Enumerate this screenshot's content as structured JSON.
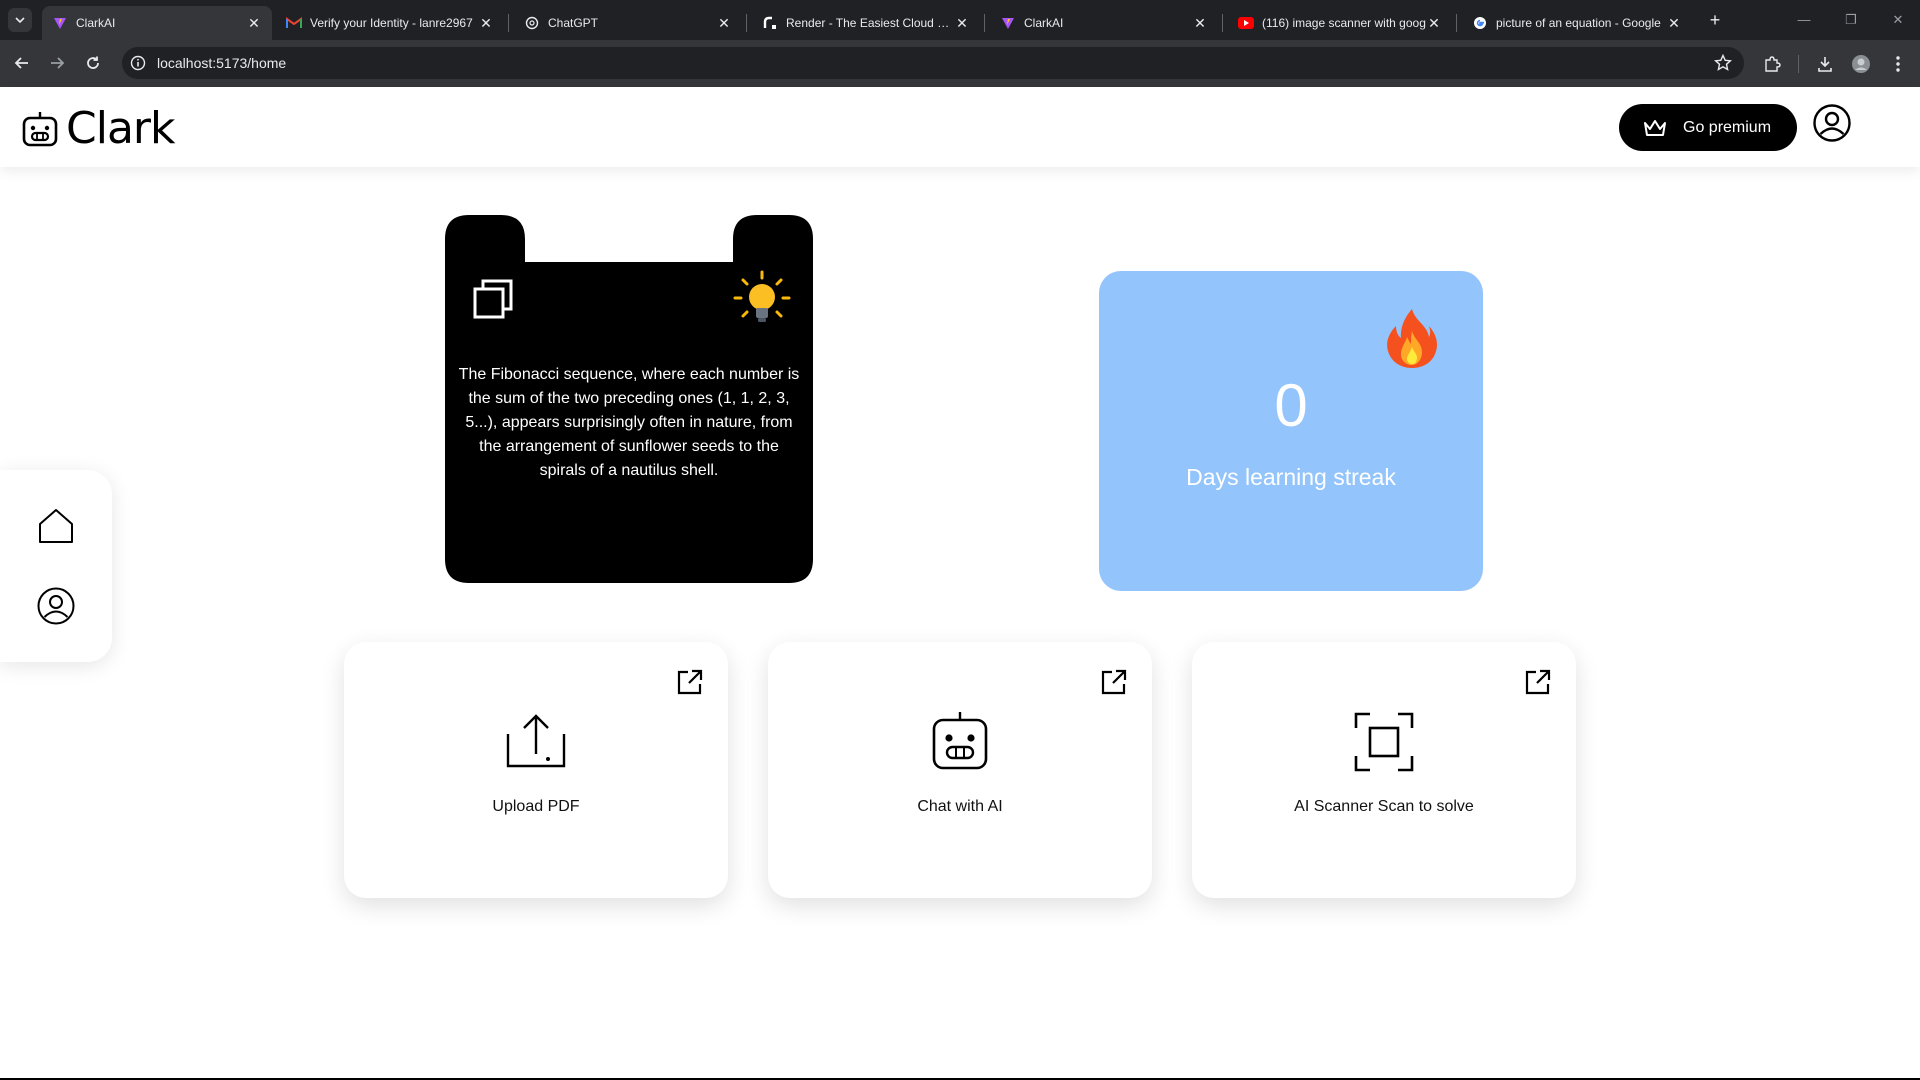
{
  "browser": {
    "tabs": [
      {
        "title": "ClarkAI",
        "favicon": "vite-icon",
        "active": true
      },
      {
        "title": "Verify your Identity - lanre2967",
        "favicon": "gmail-icon",
        "active": false
      },
      {
        "title": "ChatGPT",
        "favicon": "openai-icon",
        "active": false
      },
      {
        "title": "Render - The Easiest Cloud For A",
        "favicon": "render-icon",
        "active": false
      },
      {
        "title": "ClarkAI",
        "favicon": "vite-icon",
        "active": false
      },
      {
        "title": "(116) image scanner with goog",
        "favicon": "youtube-icon",
        "active": false
      },
      {
        "title": "picture of an equation - Google",
        "favicon": "google-icon",
        "active": false
      }
    ],
    "url": "localhost:5173/home"
  },
  "app": {
    "logo_text": "Clark",
    "premium_label": "Go premium",
    "fact_text": "The Fibonacci sequence, where each number is the sum of the two preceding ones (1, 1, 2, 3, 5...), appears surprisingly often in nature, from the arrangement of sunflower seeds to the spirals of a nautilus shell.",
    "streak": {
      "value": "0",
      "label": "Days learning streak"
    },
    "actions": [
      {
        "label": "Upload PDF",
        "icon": "upload-icon"
      },
      {
        "label": "Chat with AI",
        "icon": "robot-icon"
      },
      {
        "label": "AI Scanner Scan to solve",
        "icon": "scan-icon"
      }
    ],
    "colors": {
      "streak_card": "#93c4fb",
      "fact_card": "#000000",
      "premium_button": "#000000"
    }
  }
}
